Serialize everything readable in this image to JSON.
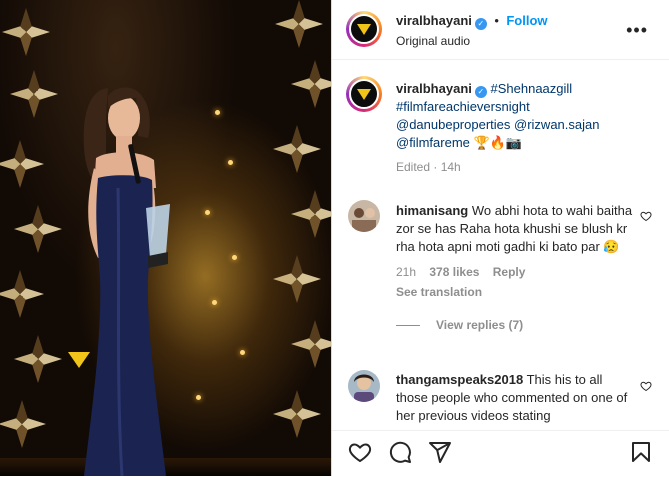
{
  "post": {
    "username": "viralbhayani",
    "follow_label": "Follow",
    "audio": "Original audio",
    "more": "•••"
  },
  "caption": {
    "username": "viralbhayani",
    "line1_tag": "#Shehnaazgill",
    "line2_tag": "#filmfareachieversnight",
    "mention1": "@danubeproperties",
    "mention2": "@rizwan.sajan",
    "mention3": "@filmfareme",
    "emojis": "🏆🔥📷",
    "meta": "Edited · 14h"
  },
  "comments": [
    {
      "username": "himanisang",
      "text": "Wo abhi hota to wahi baitha zor se has Raha hota khushi se blush kr rha hota apni moti gadhi ki bato par 😥",
      "time": "21h",
      "likes": "378 likes",
      "reply": "Reply",
      "see_translation": "See translation",
      "view_replies": "View replies (7)"
    },
    {
      "username": "thangamspeaks2018",
      "text": "This his to all those people who commented on one of her previous videos stating"
    }
  ],
  "icons": {
    "like": "heart-icon",
    "comment": "comment-icon",
    "share": "paper-plane-icon",
    "save": "bookmark-icon"
  },
  "colors": {
    "follow": "#0095f6",
    "link": "#00376b",
    "verified": "#3897f0",
    "dress": "#1b2350"
  }
}
